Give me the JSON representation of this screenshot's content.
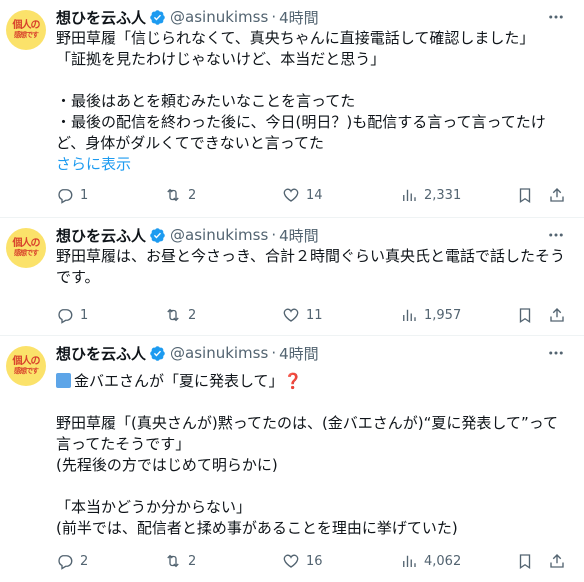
{
  "colors": {
    "link": "#1d9bf0",
    "muted": "#536471",
    "verified": "#1d9bf0",
    "avatar_bg": "#fbe26a"
  },
  "tweets": [
    {
      "name": "想ひを云ふ人",
      "handle": "@asinukimss",
      "dot": "·",
      "time": "4時間",
      "avatar": {
        "line1": "個人の",
        "line2": "感想です"
      },
      "lines": [
        "野田草履「信じられなくて、真央ちゃんに直接電話して確認しました」",
        "「証拠を見たわけじゃないけど、本当だと思う」",
        "",
        "・最後はあとを頼むみたいなことを言ってた",
        "・最後の配信を終わった後に、今日(明日？)も配信する言って言ってたけ",
        "ど、身体がダルくてできないと言ってた"
      ],
      "show_more": "さらに表示",
      "counts": {
        "replies": "1",
        "reposts": "2",
        "likes": "14",
        "views": "2,331"
      }
    },
    {
      "name": "想ひを云ふ人",
      "handle": "@asinukimss",
      "dot": "·",
      "time": "4時間",
      "avatar": {
        "line1": "個人の",
        "line2": "感想です"
      },
      "lines": [
        "野田草履は、お昼と今さっき、合計２時間ぐらい真央氏と電話で話したそう",
        "です。"
      ],
      "counts": {
        "replies": "1",
        "reposts": "2",
        "likes": "11",
        "views": "1,957"
      }
    },
    {
      "name": "想ひを云ふ人",
      "handle": "@asinukimss",
      "dot": "·",
      "time": "4時間",
      "avatar": {
        "line1": "個人の",
        "line2": "感想です"
      },
      "first_line": "金バエさんが「夏に発表して」",
      "first_line_emoji": "❓",
      "lines": [
        "",
        "野田草履「(真央さんが)黙ってたのは、(金バエさんが)“夏に発表して”って",
        "言ってたそうです」",
        "(先程後の方ではじめて明らかに)",
        "",
        "「本当かどうか分からない」",
        "(前半では、配信者と揉め事があることを理由に挙げていた)"
      ],
      "counts": {
        "replies": "2",
        "reposts": "2",
        "likes": "16",
        "views": "4,062"
      }
    }
  ]
}
